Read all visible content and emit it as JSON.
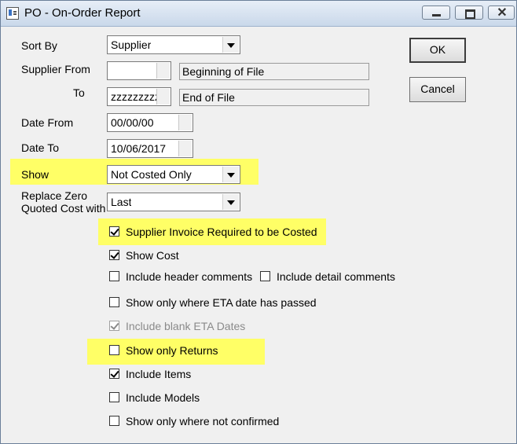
{
  "window": {
    "title": "PO - On-Order Report",
    "icon": "report-window-icon",
    "close_glyph": "✕"
  },
  "form": {
    "sort_by": {
      "label": "Sort By",
      "value": "Supplier"
    },
    "supplier_from": {
      "label": "Supplier From",
      "value": "",
      "description": "Beginning of File"
    },
    "supplier_to": {
      "label": "To",
      "value": "zzzzzzzzz:",
      "description": "End of File"
    },
    "date_from": {
      "label": "Date From",
      "value": "00/00/00"
    },
    "date_to": {
      "label": "Date To",
      "value": "10/06/2017"
    },
    "show": {
      "label": "Show",
      "value": "Not Costed Only"
    },
    "replace_zero": {
      "label_line1": "Replace Zero",
      "label_line2": "Quoted Cost with",
      "value": "Last"
    }
  },
  "checkboxes": {
    "supplier_invoice_required": {
      "label": "Supplier Invoice Required to be Costed",
      "checked": true
    },
    "show_cost": {
      "label": "Show Cost",
      "checked": true
    },
    "include_header_comments": {
      "label": "Include header comments",
      "checked": false
    },
    "include_detail_comments": {
      "label": "Include detail comments",
      "checked": false
    },
    "show_eta_passed": {
      "label": "Show only where ETA date has passed",
      "checked": false
    },
    "include_blank_eta": {
      "label": "Include blank ETA Dates",
      "checked": true,
      "disabled": true
    },
    "show_only_returns": {
      "label": "Show only Returns",
      "checked": false
    },
    "include_items": {
      "label": "Include Items",
      "checked": true
    },
    "include_models": {
      "label": "Include Models",
      "checked": false
    },
    "show_not_confirmed": {
      "label": "Show only where not confirmed",
      "checked": false
    }
  },
  "buttons": {
    "ok": "OK",
    "cancel": "Cancel"
  },
  "colors": {
    "highlight": "#ffff66",
    "titlebar": "#c9d8ea",
    "dialog_bg": "#f0f0f0"
  }
}
